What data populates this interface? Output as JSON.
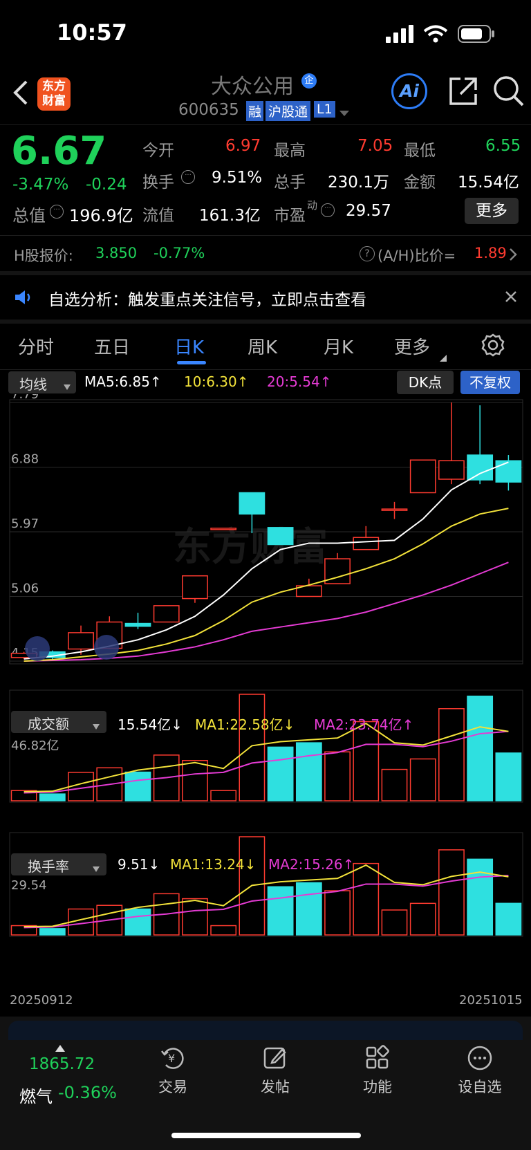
{
  "status_bar": {
    "time": "10:57"
  },
  "header": {
    "logo_text": "东方财富",
    "stock_name": "大众公用",
    "stock_code": "600635",
    "tag_rong": "融",
    "tag_hgt": "沪股通",
    "tag_level": "L1",
    "ai_label": "Ai"
  },
  "quote": {
    "price": "6.67",
    "pct_change": "-3.47%",
    "change": "-0.24",
    "open_label": "今开",
    "open": "6.97",
    "high_label": "最高",
    "high": "7.05",
    "low_label": "最低",
    "low": "6.55",
    "turnover_label": "换手",
    "turnover": "9.51%",
    "volume_label": "总手",
    "volume": "230.1万",
    "amount_label": "金额",
    "amount": "15.54亿",
    "mktcap_label": "总值",
    "mktcap": "196.9亿",
    "float_label": "流值",
    "float_cap": "161.3亿",
    "pe_label": "市盈",
    "pe_sup": "动",
    "pe": "29.57",
    "more_button": "更多"
  },
  "hshare": {
    "label": "H股报价:",
    "price": "3.850",
    "change": "-0.77%",
    "ah_label": "(A/H)比价=",
    "ah_value": "1.89"
  },
  "notice": {
    "text": "自选分析：触发重点关注信号，立即点击查看"
  },
  "tabs": [
    "分时",
    "五日",
    "日K",
    "周K",
    "月K",
    "更多"
  ],
  "active_tab": "日K",
  "kline_toolbar": {
    "indicator": "均线",
    "ma5": "MA5:6.85↑",
    "ma10": "10:6.30↑",
    "ma20": "20:5.54↑",
    "dk_button": "DK点",
    "adjust_button": "不复权"
  },
  "watermark": "东方财富",
  "volume_toolbar": {
    "indicator": "成交额",
    "value": "15.54亿↓",
    "ma1": "MA1:22.58亿↓",
    "ma2": "MA2:23.74亿↑",
    "top_label": "46.82亿"
  },
  "turnover_toolbar": {
    "indicator": "换手率",
    "value": "9.51↓",
    "ma1": "MA1:13.24↓",
    "ma2": "MA2:15.26↑",
    "top_label": "29.54"
  },
  "date_start": "20250912",
  "date_end": "20251015",
  "bottom_nav": {
    "index_value": "1865.72",
    "index_name": "燃气",
    "index_change": "-0.36%",
    "items": [
      "交易",
      "发帖",
      "功能",
      "设自选"
    ]
  },
  "colors": {
    "up": "#ff3b30",
    "down": "#2ee0e0",
    "accent": "#2d7cf6",
    "ma5": "#ffffff",
    "ma10": "#f2e23a",
    "ma20": "#e53bd4"
  },
  "chart_data": [
    {
      "type": "candlestick",
      "title": "日K",
      "ylim": [
        4.15,
        7.79
      ],
      "y_ticks": [
        "7.79",
        "6.88",
        "5.97",
        "5.06",
        "4.15"
      ],
      "candles": [
        {
          "o": 4.2,
          "c": 4.26,
          "h": 4.28,
          "l": 4.18
        },
        {
          "o": 4.28,
          "c": 4.2,
          "h": 4.3,
          "l": 4.17
        },
        {
          "o": 4.32,
          "c": 4.55,
          "h": 4.65,
          "l": 4.24
        },
        {
          "o": 4.33,
          "c": 4.7,
          "h": 4.78,
          "l": 4.32
        },
        {
          "o": 4.68,
          "c": 4.64,
          "h": 4.83,
          "l": 4.6
        },
        {
          "o": 4.7,
          "c": 4.93,
          "h": 4.93,
          "l": 4.7
        },
        {
          "o": 5.03,
          "c": 5.35,
          "h": 5.35,
          "l": 4.97
        },
        {
          "o": 6.02,
          "c": 6.02,
          "h": 6.02,
          "l": 6.02
        },
        {
          "o": 6.52,
          "c": 6.22,
          "h": 6.52,
          "l": 5.95
        },
        {
          "o": 6.03,
          "c": 5.79,
          "h": 6.03,
          "l": 5.79
        },
        {
          "o": 5.06,
          "c": 5.21,
          "h": 5.31,
          "l": 5.06
        },
        {
          "o": 5.24,
          "c": 5.59,
          "h": 5.67,
          "l": 5.24
        },
        {
          "o": 5.72,
          "c": 5.89,
          "h": 6.05,
          "l": 5.72
        },
        {
          "o": 6.29,
          "c": 6.29,
          "h": 6.39,
          "l": 6.15
        },
        {
          "o": 6.52,
          "c": 6.98,
          "h": 6.98,
          "l": 6.52
        },
        {
          "o": 6.71,
          "c": 6.97,
          "h": 7.79,
          "l": 6.64
        },
        {
          "o": 7.05,
          "c": 6.7,
          "h": 7.75,
          "l": 6.64
        },
        {
          "o": 6.97,
          "c": 6.67,
          "h": 7.05,
          "l": 6.55
        }
      ],
      "ma5": [
        4.18,
        4.22,
        4.28,
        4.36,
        4.45,
        4.59,
        4.78,
        5.08,
        5.45,
        5.72,
        5.81,
        5.81,
        5.83,
        5.85,
        6.15,
        6.56,
        6.79,
        6.95
      ],
      "ma10": [
        4.15,
        4.17,
        4.21,
        4.25,
        4.3,
        4.39,
        4.51,
        4.72,
        4.98,
        5.12,
        5.22,
        5.33,
        5.45,
        5.59,
        5.8,
        6.05,
        6.22,
        6.3
      ],
      "ma20": [
        4.15,
        4.16,
        4.17,
        4.19,
        4.22,
        4.28,
        4.35,
        4.45,
        4.57,
        4.63,
        4.69,
        4.75,
        4.84,
        4.96,
        5.08,
        5.22,
        5.38,
        5.54
      ]
    },
    {
      "type": "bar",
      "title": "成交额",
      "ylim": [
        0,
        46.82
      ],
      "values": [
        4.5,
        3.0,
        12.5,
        14.5,
        12.6,
        20.1,
        17.7,
        4.5,
        46.82,
        23.6,
        25.5,
        21.5,
        34.8,
        13.8,
        18.4,
        40.5,
        46.0,
        21.0
      ],
      "direction": [
        "up",
        "down",
        "up",
        "up",
        "down",
        "up",
        "up",
        "up",
        "up",
        "down",
        "down",
        "up",
        "up",
        "up",
        "up",
        "up",
        "down",
        "down"
      ],
      "ma1": [
        4.0,
        4.2,
        7.5,
        10.5,
        13.5,
        15.0,
        16.8,
        14.2,
        24.2,
        26.0,
        26.8,
        27.6,
        34.0,
        25.5,
        24.5,
        28.5,
        32.5,
        30.5
      ],
      "ma2": [
        3.5,
        3.8,
        5.5,
        7.2,
        9.0,
        10.2,
        11.8,
        12.5,
        16.6,
        18.0,
        19.8,
        21.2,
        24.8,
        24.8,
        23.8,
        26.2,
        29.5,
        30.5
      ]
    },
    {
      "type": "bar",
      "title": "换手率",
      "ylim": [
        0,
        29.54
      ],
      "values": [
        2.8,
        1.9,
        7.8,
        8.9,
        7.8,
        12.4,
        10.9,
        2.8,
        29.54,
        14.5,
        15.7,
        13.3,
        21.5,
        7.5,
        9.5,
        25.6,
        22.8,
        9.51
      ],
      "direction": [
        "up",
        "down",
        "up",
        "up",
        "down",
        "up",
        "up",
        "up",
        "up",
        "down",
        "down",
        "up",
        "up",
        "up",
        "up",
        "up",
        "down",
        "down"
      ],
      "ma1": [
        2.5,
        2.6,
        4.6,
        6.5,
        8.3,
        9.3,
        10.4,
        8.8,
        14.9,
        16.0,
        16.5,
        17.0,
        21.0,
        15.8,
        15.1,
        17.6,
        18.9,
        17.5
      ],
      "ma2": [
        2.2,
        2.4,
        3.4,
        4.5,
        5.6,
        6.3,
        7.3,
        7.7,
        10.2,
        11.1,
        12.2,
        13.1,
        15.3,
        15.3,
        14.7,
        16.2,
        17.4,
        17.9
      ]
    }
  ]
}
